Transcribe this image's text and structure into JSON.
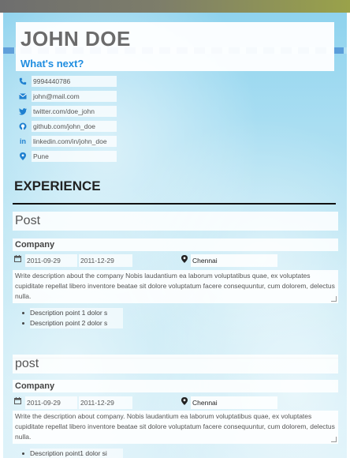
{
  "header": {
    "name": "JOHN DOE",
    "tagline": "What's next?"
  },
  "contacts": [
    {
      "icon": "phone-icon",
      "value": "9994440786"
    },
    {
      "icon": "mail-icon",
      "value": "john@mail.com"
    },
    {
      "icon": "twitter-icon",
      "value": "twitter.com/doe_john"
    },
    {
      "icon": "github-icon",
      "value": "github.com/john_doe"
    },
    {
      "icon": "linkedin-icon",
      "value": "linkedin.com/in/john_doe"
    },
    {
      "icon": "location-pin-icon",
      "value": "Pune"
    }
  ],
  "experience": {
    "section_title": "EXPERIENCE",
    "entries": [
      {
        "post": "Post",
        "company": "Company",
        "start_date": "2011-09-29",
        "end_date": "2011-12-29",
        "location": "Chennai",
        "description": "Write description about the company Nobis laudantium ea laborum voluptatibus quae, ex voluptates cupiditate repellat libero inventore beatae sit dolore voluptatum facere consequuntur, cum dolorem, delectus nulla.",
        "points": [
          "Description point 1 dolor s",
          "Description point 2 dolor s"
        ]
      },
      {
        "post": "post",
        "company": "Company",
        "start_date": "2011-09-29",
        "end_date": "2011-12-29",
        "location": "Chennai",
        "description": "Write the description about company. Nobis laudantium ea laborum voluptatibus quae, ex voluptates cupiditate repellat libero inventore beatae sit dolore voluptatum facere consequuntur, cum dolorem, delectus nulla.",
        "points": [
          "Description point1 dolor si"
        ]
      }
    ]
  },
  "colors": {
    "accent": "#1f8de0",
    "name": "#6b6b6b",
    "background": "#a9def2"
  }
}
